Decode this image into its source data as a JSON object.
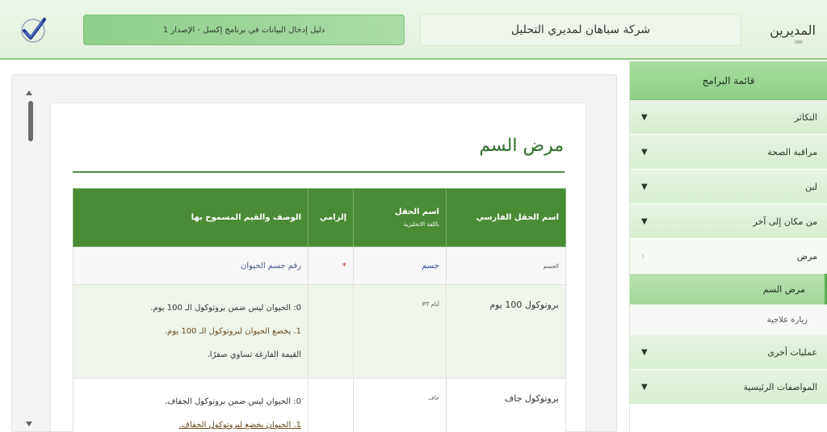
{
  "header": {
    "brand": "المديرين",
    "company": "شركة سباهان لمديري التحليل",
    "guide": "دليل إدخال البيانات في برنامج إكسل - الإصدار 1"
  },
  "sidebar": {
    "title": "قائمة البرامج",
    "items": [
      {
        "label": "التكاثر"
      },
      {
        "label": "مراقبة الصحة"
      },
      {
        "label": "لبن"
      },
      {
        "label": "من مكان إلى آخر"
      },
      {
        "label": "مرض",
        "badge": "١"
      }
    ],
    "sub_items": [
      {
        "label": "مرض السم"
      },
      {
        "label": "زيارة علاجية"
      }
    ],
    "items_after": [
      {
        "label": "عمليات أخرى"
      },
      {
        "label": "المواصفات الرئيسية"
      }
    ]
  },
  "content": {
    "title": "مرض السم",
    "table": {
      "headers": {
        "fa": "اسم الحقل الفارسي",
        "en": "اسم الحقل",
        "en_sub": "باللغة الانجليزية",
        "req": "إلزامي",
        "desc": "الوصف والقيم المسموح بها"
      },
      "rows": [
        {
          "fa": "الجسم",
          "en": "جسم",
          "req": "*",
          "desc": "رقم جسم الحيوان"
        },
        {
          "fa": "بروتوكول 100 يوم",
          "en": "أيام PT",
          "req": "",
          "desc_lines": [
            "0: الحيوان ليس ضمن بروتوكول الـ 100 يوم.",
            "1. يخضع الحيوان لبروتوكول الـ 100 يوم.",
            "القيمة الفارغة تساوي صفرًا."
          ]
        },
        {
          "fa": "بروتوكول جاف",
          "en": "جاف",
          "req": "",
          "desc_lines": [
            "0: الحيوان ليس ضمن بروتوكول الجفاف.",
            "1. الحيوان يخضع لبروتوكول الجفاف."
          ]
        }
      ]
    }
  },
  "colors": {
    "accent_green": "#4a8b36",
    "title_green": "#2c6e28",
    "sidebar_active": "#a3d89a"
  },
  "icons": {
    "logo": "checkmark-logo-icon",
    "chevron": "chevron-down-icon"
  }
}
